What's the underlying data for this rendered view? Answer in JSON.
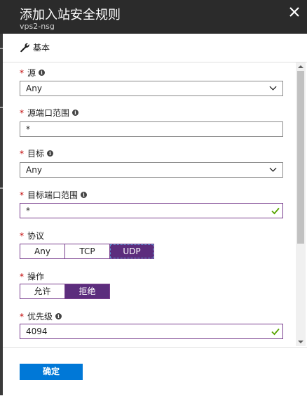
{
  "header": {
    "title": "添加入站安全规则",
    "subtitle": "vps2-nsg",
    "close_icon": "close-icon"
  },
  "toolbar": {
    "basic_label": "基本",
    "basic_icon": "wrench-icon"
  },
  "form": {
    "source": {
      "label": "源",
      "value": "Any"
    },
    "source_port": {
      "label": "源端口范围",
      "value": "*"
    },
    "destination": {
      "label": "目标",
      "value": "Any"
    },
    "destination_port": {
      "label": "目标端口范围",
      "value": "*"
    },
    "protocol": {
      "label": "协议",
      "options": [
        "Any",
        "TCP",
        "UDP"
      ],
      "selected": "UDP"
    },
    "action": {
      "label": "操作",
      "options": [
        "允许",
        "拒绝"
      ],
      "selected": "拒绝"
    },
    "priority": {
      "label": "优先级",
      "value": "4094"
    }
  },
  "footer": {
    "ok_label": "确定"
  },
  "colors": {
    "header_bg": "#2b2b2b",
    "accent_purple": "#5c2d7d",
    "primary_blue": "#0078d7",
    "valid_green": "#57a300",
    "required_red": "#c00000"
  }
}
